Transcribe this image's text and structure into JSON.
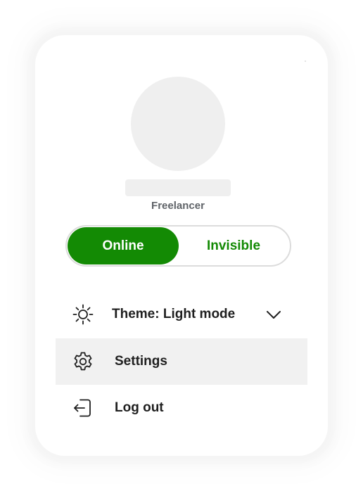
{
  "profile": {
    "role": "Freelancer"
  },
  "status": {
    "options": [
      "Online",
      "Invisible"
    ],
    "selected": "Online",
    "colors": {
      "accent": "#138a04",
      "accent_text_on_selected": "#ffffff"
    }
  },
  "menu": {
    "theme": {
      "label": "Theme: Light mode",
      "icon": "sun-icon",
      "expand_icon": "chevron-down-icon"
    },
    "settings": {
      "label": "Settings",
      "icon": "gear-icon",
      "highlighted": true
    },
    "logout": {
      "label": "Log out",
      "icon": "logout-icon"
    }
  }
}
